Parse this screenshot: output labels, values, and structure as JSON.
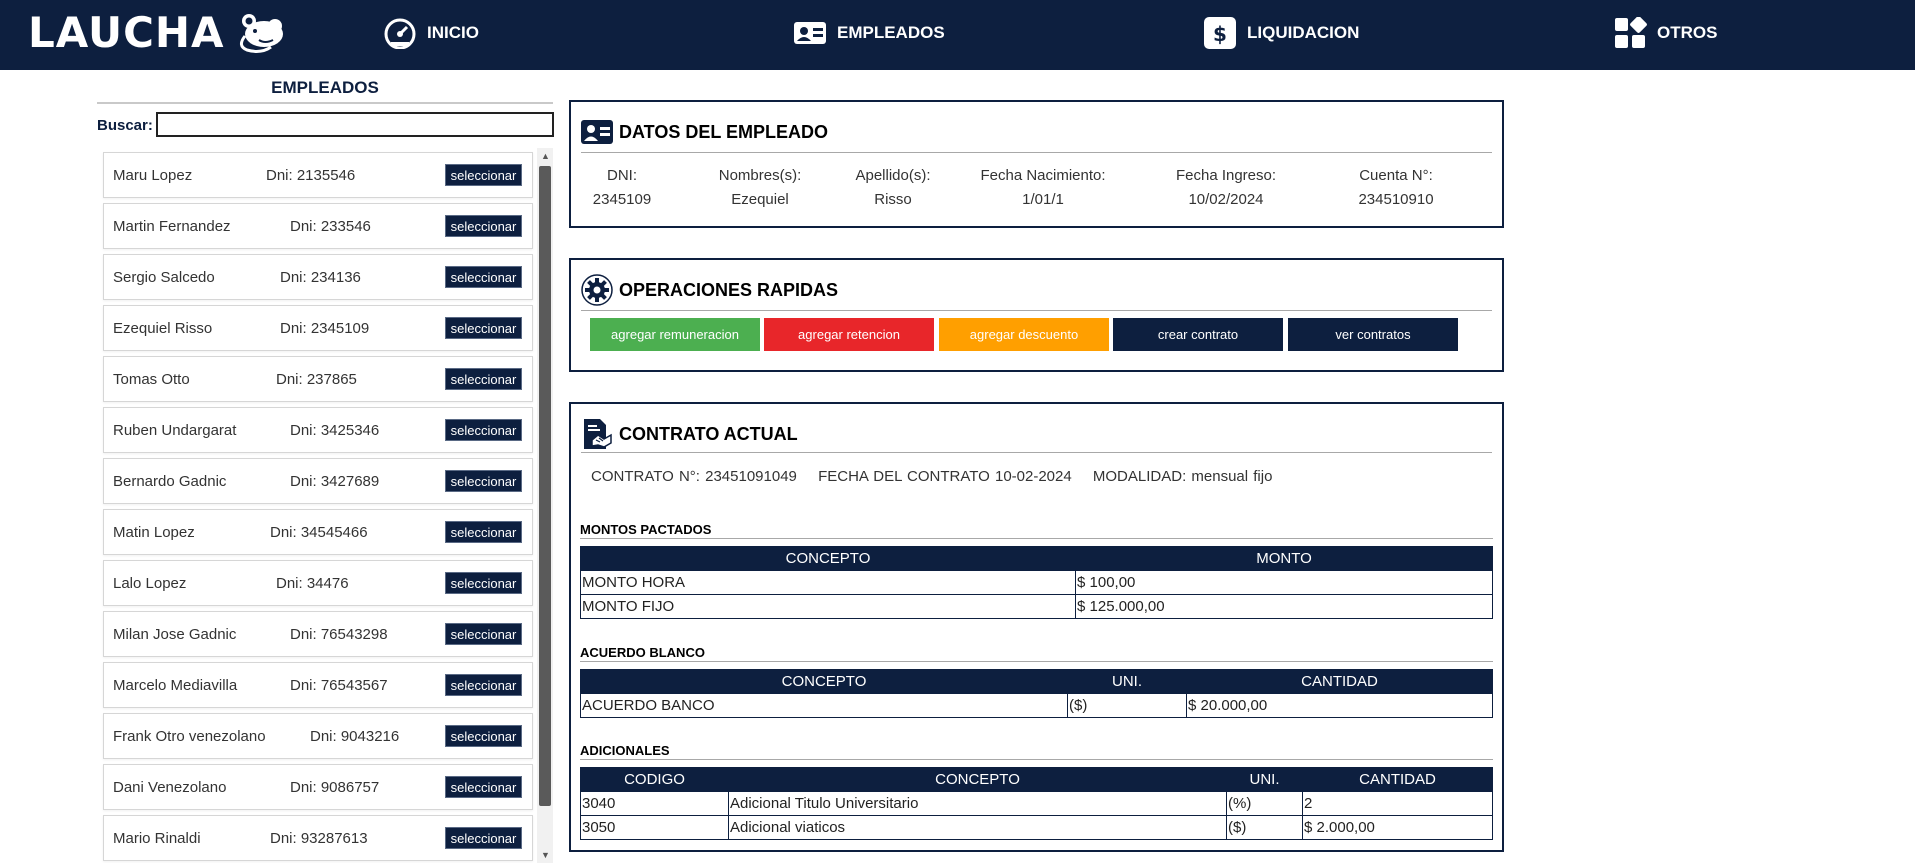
{
  "brand": {
    "name": "LAUCHA",
    "logo_icon": "mouse-icon"
  },
  "nav": [
    {
      "label": "INICIO",
      "icon": "speedometer-icon"
    },
    {
      "label": "EMPLEADOS",
      "icon": "id-card-icon"
    },
    {
      "label": "LIQUIDACION",
      "icon": "dollar-icon"
    },
    {
      "label": "OTROS",
      "icon": "grid-icon"
    }
  ],
  "employees_panel": {
    "title": "EMPLEADOS",
    "search_label": "Buscar:",
    "search_value": "",
    "items": [
      {
        "name": "Maru Lopez",
        "dni": "Dni: 2135546",
        "button": "seleccionar"
      },
      {
        "name": "Martin Fernandez",
        "dni": "Dni: 233546",
        "button": "seleccionar"
      },
      {
        "name": "Sergio Salcedo",
        "dni": "Dni: 234136",
        "button": "seleccionar"
      },
      {
        "name": "Ezequiel Risso",
        "dni": "Dni: 2345109",
        "button": "seleccionar"
      },
      {
        "name": "Tomas Otto",
        "dni": "Dni: 237865",
        "button": "seleccionar"
      },
      {
        "name": "Ruben Undargarat",
        "dni": "Dni: 3425346",
        "button": "seleccionar"
      },
      {
        "name": "Bernardo Gadnic",
        "dni": "Dni: 3427689",
        "button": "seleccionar"
      },
      {
        "name": "Matin Lopez",
        "dni": "Dni: 34545466",
        "button": "seleccionar"
      },
      {
        "name": "Lalo Lopez",
        "dni": "Dni: 34476",
        "button": "seleccionar"
      },
      {
        "name": "Milan Jose Gadnic",
        "dni": "Dni: 76543298",
        "button": "seleccionar"
      },
      {
        "name": "Marcelo Mediavilla",
        "dni": "Dni: 76543567",
        "button": "seleccionar"
      },
      {
        "name": "Frank Otro venezolano",
        "dni": "Dni: 9043216",
        "button": "seleccionar"
      },
      {
        "name": "Dani Venezolano",
        "dni": "Dni: 9086757",
        "button": "seleccionar"
      },
      {
        "name": "Mario Rinaldi",
        "dni": "Dni: 93287613",
        "button": "seleccionar"
      }
    ]
  },
  "employee_data": {
    "title": "DATOS DEL EMPLEADO",
    "fields": [
      {
        "label": "DNI:",
        "value": "2345109"
      },
      {
        "label": "Nombres(s):",
        "value": "Ezequiel"
      },
      {
        "label": "Apellido(s):",
        "value": "Risso"
      },
      {
        "label": "Fecha Nacimiento:",
        "value": "1/01/1"
      },
      {
        "label": "Fecha Ingreso:",
        "value": "10/02/2024"
      },
      {
        "label": "Cuenta N°:",
        "value": "234510910"
      }
    ]
  },
  "quick_ops": {
    "title": "OPERACIONES RAPIDAS",
    "buttons": [
      {
        "label": "agregar remuneracion",
        "color": "#4caf50"
      },
      {
        "label": "agregar retencion",
        "color": "#e8262a"
      },
      {
        "label": "agregar descuento",
        "color": "#ff9f00"
      },
      {
        "label": "crear contrato",
        "color": "#0d1f3f"
      },
      {
        "label": "ver contratos",
        "color": "#0d1f3f"
      }
    ]
  },
  "contract": {
    "title": "CONTRATO ACTUAL",
    "number": "CONTRATO N°: 23451091049",
    "date": "FECHA DEL CONTRATO 10-02-2024",
    "modality": "MODALIDAD: mensual fijo",
    "montos": {
      "label": "MONTOS PACTADOS",
      "headers": [
        "CONCEPTO",
        "MONTO"
      ],
      "rows": [
        [
          "MONTO HORA",
          "$ 100,00"
        ],
        [
          "MONTO FIJO",
          "$ 125.000,00"
        ]
      ]
    },
    "acuerdo": {
      "label": "ACUERDO BLANCO",
      "headers": [
        "CONCEPTO",
        "UNI.",
        "CANTIDAD"
      ],
      "rows": [
        [
          "ACUERDO BANCO",
          "($)",
          "$ 20.000,00"
        ]
      ]
    },
    "adicionales": {
      "label": "ADICIONALES",
      "headers": [
        "CODIGO",
        "CONCEPTO",
        "UNI.",
        "CANTIDAD"
      ],
      "rows": [
        [
          "3040",
          "Adicional Titulo Universitario",
          "(%)",
          "2"
        ],
        [
          "3050",
          "Adicional viaticos",
          "($)",
          "$ 2.000,00"
        ]
      ]
    }
  },
  "colors": {
    "navy": "#0d1f3f",
    "green": "#4caf50",
    "red": "#e8262a",
    "orange": "#ff9f00"
  }
}
